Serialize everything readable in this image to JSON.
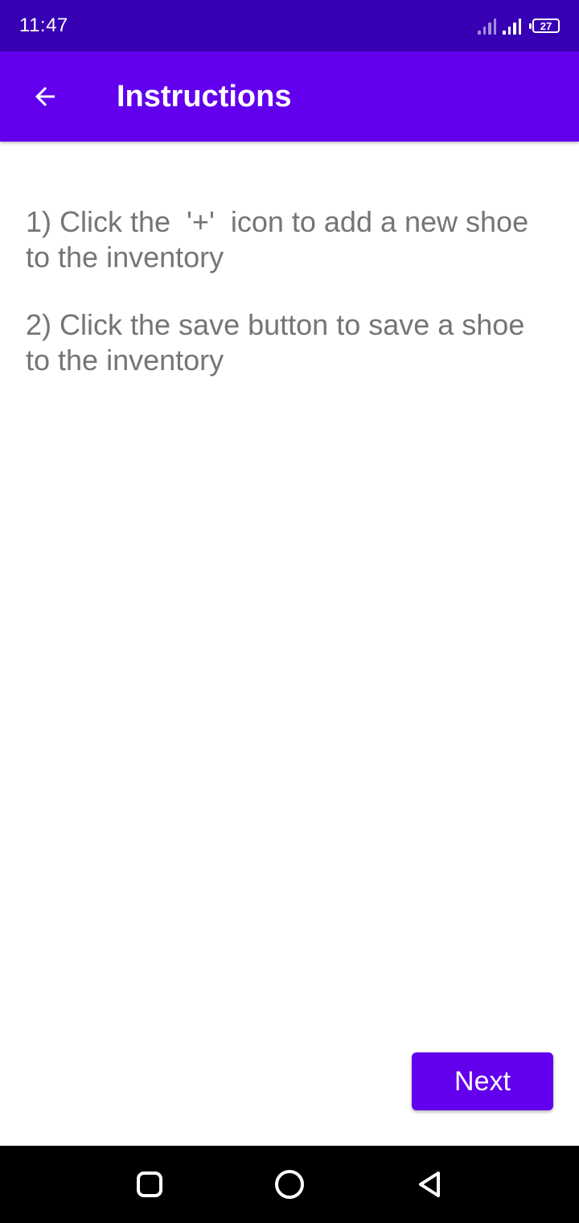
{
  "status_bar": {
    "time": "11:47",
    "battery_level": "27"
  },
  "app_bar": {
    "title": "Instructions",
    "back_icon": "arrow-back-icon"
  },
  "instructions": [
    "1) Click the  '+'  icon to add a new shoe to the inventory",
    "2) Click the save button to save a shoe to the inventory"
  ],
  "next_button": {
    "label": "Next"
  },
  "nav_bar": {
    "recents_icon": "recents-square-icon",
    "home_icon": "home-circle-icon",
    "back_icon": "back-triangle-icon"
  },
  "colors": {
    "status_bar": "#3700b3",
    "primary": "#6200ee",
    "body_text": "#757575",
    "nav_bar": "#000000"
  }
}
